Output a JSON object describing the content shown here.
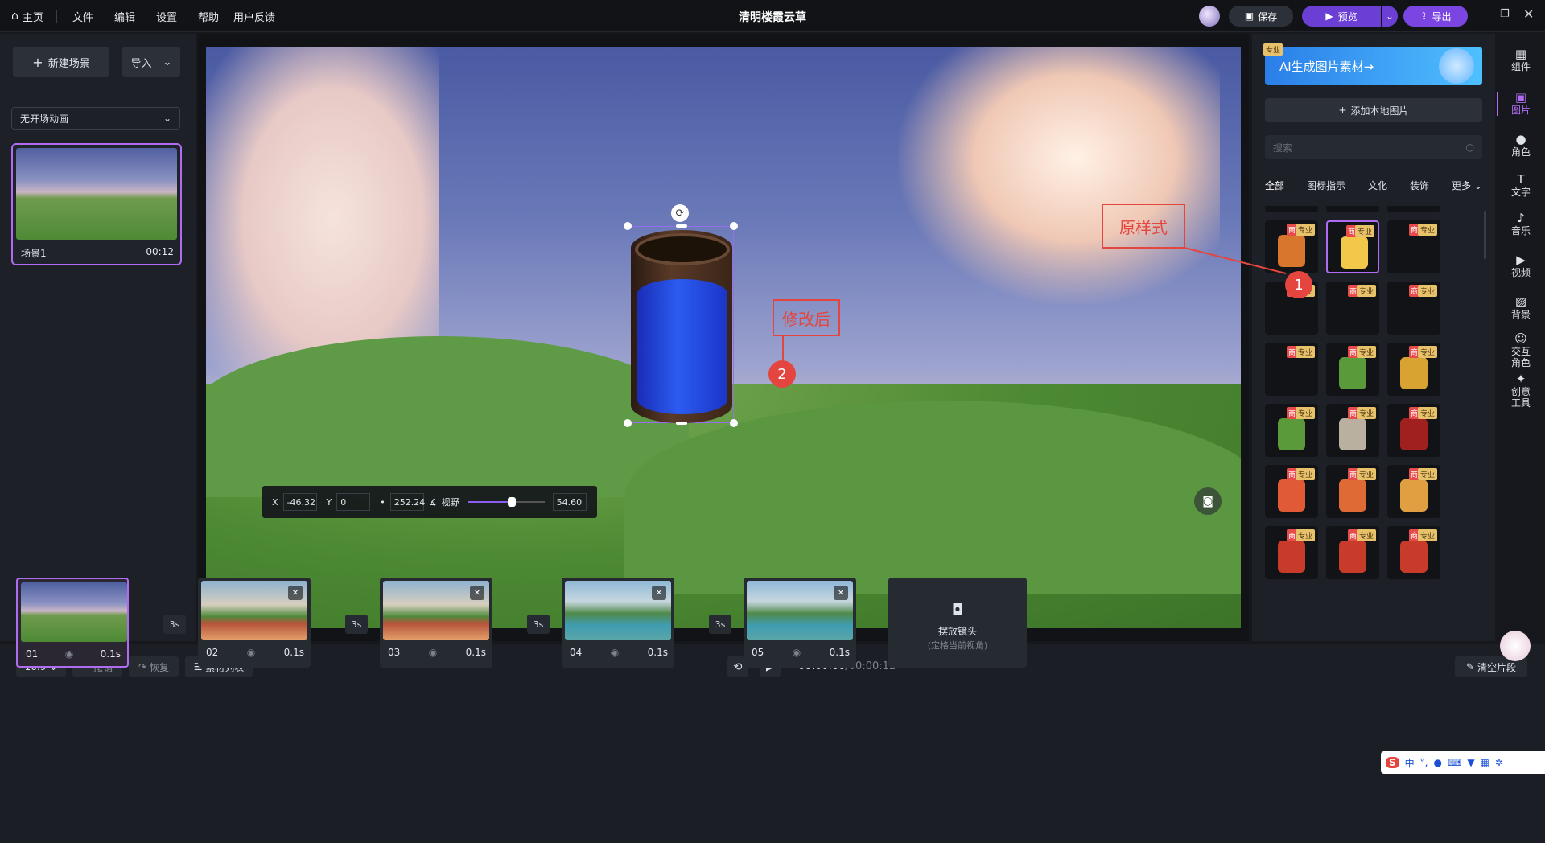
{
  "app": {
    "title": "清明楼霞云草",
    "home_label": "主页",
    "menu": [
      "文件",
      "编辑",
      "设置",
      "帮助",
      "用户反馈"
    ],
    "save_label": "保存",
    "preview_label": "预览",
    "export_label": "导出"
  },
  "left": {
    "new_scene_label": "新建场景",
    "import_label": "导入",
    "scene_anim_select": "无开场动画",
    "scenes": [
      {
        "name": "场景1",
        "duration": "00:12"
      }
    ]
  },
  "viewport": {
    "x_label": "X",
    "x_value": "-46.32",
    "y_label": "Y",
    "y_value": "0",
    "sep": "•",
    "z_value": "252.24",
    "fov_label": "视野",
    "fov_value": "54.60",
    "fov_fraction": 0.58,
    "annotation_original": "原样式",
    "annotation_modified": "修改后",
    "marker1": "1",
    "marker2": "2"
  },
  "right": {
    "pro_badge": "专业",
    "ai_banner": "AI生成图片素材→",
    "add_local": "添加本地图片",
    "search_placeholder": "搜索",
    "categories": [
      "全部",
      "图标指示",
      "文化",
      "装饰",
      "更多"
    ],
    "tag_commercial": "商",
    "tag_pro": "专业"
  },
  "sidebar": [
    {
      "label": "组件",
      "icon": "grid-icon"
    },
    {
      "label": "图片",
      "icon": "image-icon"
    },
    {
      "label": "角色",
      "icon": "person-icon"
    },
    {
      "label": "文字",
      "icon": "text-icon"
    },
    {
      "label": "音乐",
      "icon": "music-icon"
    },
    {
      "label": "视频",
      "icon": "video-icon"
    },
    {
      "label": "背景",
      "icon": "background-icon"
    },
    {
      "label": "交互\n角色",
      "icon": "interactive-role-icon"
    },
    {
      "label": "创意\n工具",
      "icon": "creative-tool-icon"
    }
  ],
  "timeline": {
    "ratio": "16:9",
    "undo": "撤销",
    "redo": "恢复",
    "asset_list": "素材列表",
    "time_current": "00:00:00",
    "time_total": "/00:00:12",
    "clear": "清空片段",
    "clips": [
      {
        "id": "01",
        "dur": "0.1s"
      },
      {
        "id": "02",
        "dur": "0.1s"
      },
      {
        "id": "03",
        "dur": "0.1s"
      },
      {
        "id": "04",
        "dur": "0.1s"
      },
      {
        "id": "05",
        "dur": "0.1s"
      }
    ],
    "transition": "3s",
    "add_camera_title": "摆放镜头",
    "add_camera_sub": "(定格当前视角)"
  }
}
